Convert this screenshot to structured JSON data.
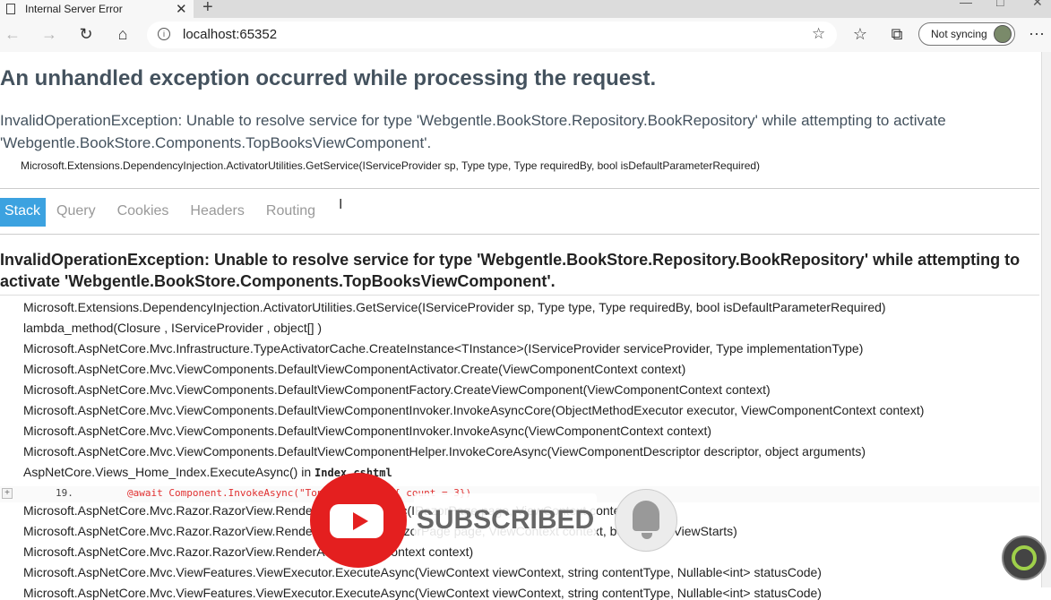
{
  "browser": {
    "tab_title": "Internal Server Error",
    "tab_close": "✕",
    "new_tab": "+",
    "url": "localhost:65352",
    "sync_label": "Not syncing",
    "more": "···"
  },
  "page": {
    "heading": "An unhandled exception occurred while processing the request.",
    "message": "InvalidOperationException: Unable to resolve service for type 'Webgentle.BookStore.Repository.BookRepository' while attempting to activate 'Webgentle.BookStore.Components.TopBooksViewComponent'.",
    "location": "Microsoft.Extensions.DependencyInjection.ActivatorUtilities.GetService(IServiceProvider sp, Type type, Type requiredBy, bool isDefaultParameterRequired)",
    "tabs": [
      "Stack",
      "Query",
      "Cookies",
      "Headers",
      "Routing"
    ],
    "stack_heading": "InvalidOperationException: Unable to resolve service for type 'Webgentle.BookStore.Repository.BookRepository' while attempting to activate 'Webgentle.BookStore.Components.TopBooksViewComponent'.",
    "frames": [
      "Microsoft.Extensions.DependencyInjection.ActivatorUtilities.GetService(IServiceProvider sp, Type type, Type requiredBy, bool isDefaultParameterRequired)",
      "lambda_method(Closure , IServiceProvider , object[] )",
      "Microsoft.AspNetCore.Mvc.Infrastructure.TypeActivatorCache.CreateInstance<TInstance>(IServiceProvider serviceProvider, Type implementationType)",
      "Microsoft.AspNetCore.Mvc.ViewComponents.DefaultViewComponentActivator.Create(ViewComponentContext context)",
      "Microsoft.AspNetCore.Mvc.ViewComponents.DefaultViewComponentFactory.CreateViewComponent(ViewComponentContext context)",
      "Microsoft.AspNetCore.Mvc.ViewComponents.DefaultViewComponentInvoker.InvokeAsyncCore(ObjectMethodExecutor executor, ViewComponentContext context)",
      "Microsoft.AspNetCore.Mvc.ViewComponents.DefaultViewComponentInvoker.InvokeAsync(ViewComponentContext context)",
      "Microsoft.AspNetCore.Mvc.ViewComponents.DefaultViewComponentHelper.InvokeCoreAsync(ViewComponentDescriptor descriptor, object arguments)"
    ],
    "razor_frame": "AspNetCore.Views_Home_Index.ExecuteAsync() in ",
    "razor_file": "Index.cshtml",
    "source_expand": "+",
    "source_line_no": "19.",
    "source_code": "@await Component.InvokeAsync(\"TopBooks\", new { count = 3})",
    "frames_after": [
      "Microsoft.AspNetCore.Mvc.Razor.RazorView.RenderPageCoreAsync(IRazorPage page, ViewContext context)",
      "Microsoft.AspNetCore.Mvc.Razor.RazorView.RenderPageAsync(IRazorPage page, ViewContext context, bool invokeViewStarts)",
      "Microsoft.AspNetCore.Mvc.Razor.RazorView.RenderAsync(ViewContext context)",
      "Microsoft.AspNetCore.Mvc.ViewFeatures.ViewExecutor.ExecuteAsync(ViewContext viewContext, string contentType, Nullable<int> statusCode)",
      "Microsoft.AspNetCore.Mvc.ViewFeatures.ViewExecutor.ExecuteAsync(ViewContext viewContext, string contentType, Nullable<int> statusCode)"
    ]
  },
  "overlay": {
    "subscribed_label": "SUBSCRIBED"
  }
}
